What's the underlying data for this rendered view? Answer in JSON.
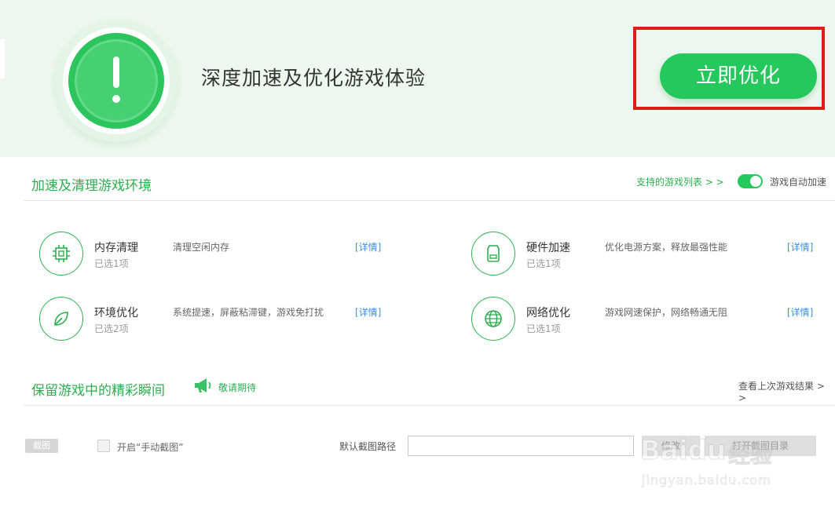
{
  "hero": {
    "title": "深度加速及优化游戏体验",
    "optimize_label": "立即优化"
  },
  "accelerate": {
    "title": "加速及清理游戏环境",
    "supported_link": "支持的游戏列表 > >",
    "auto_toggle_label": "游戏自动加速",
    "auto_toggle_on": true,
    "features": [
      {
        "icon": "chip-icon",
        "name": "内存清理",
        "selected": "已选1项",
        "desc": "清理空闲内存",
        "detail": "[详情]"
      },
      {
        "icon": "hard-drive-icon",
        "name": "硬件加速",
        "selected": "已选1项",
        "desc": "优化电源方案，释放最强性能",
        "detail": "[详情]"
      },
      {
        "icon": "leaf-icon",
        "name": "环境优化",
        "selected": "已选2项",
        "desc": "系统提速，屏蔽粘滞键，游戏免打扰",
        "detail": "[详情]"
      },
      {
        "icon": "globe-icon",
        "name": "网络优化",
        "selected": "已选1项",
        "desc": "游戏网速保护，网络畅通无阻",
        "detail": "[详情]"
      }
    ]
  },
  "moments": {
    "title": "保留游戏中的精彩瞬间",
    "coming_soon": "敬请期待",
    "last_result_link": "查看上次游戏结果 > >",
    "screenshot_tag": "截图",
    "manual_label": "开启“手动截图”",
    "path_label": "默认截图路径",
    "path_value": "",
    "modify_label": "修改",
    "open_dir_label": "打开截图目录"
  },
  "watermark": {
    "logo": "Baidu",
    "jingyan": "经验",
    "url": "jingyan.baidu.com"
  },
  "colors": {
    "brand_green": "#25c85c",
    "link_blue": "#3b8fe0",
    "highlight_red": "#e01919"
  }
}
